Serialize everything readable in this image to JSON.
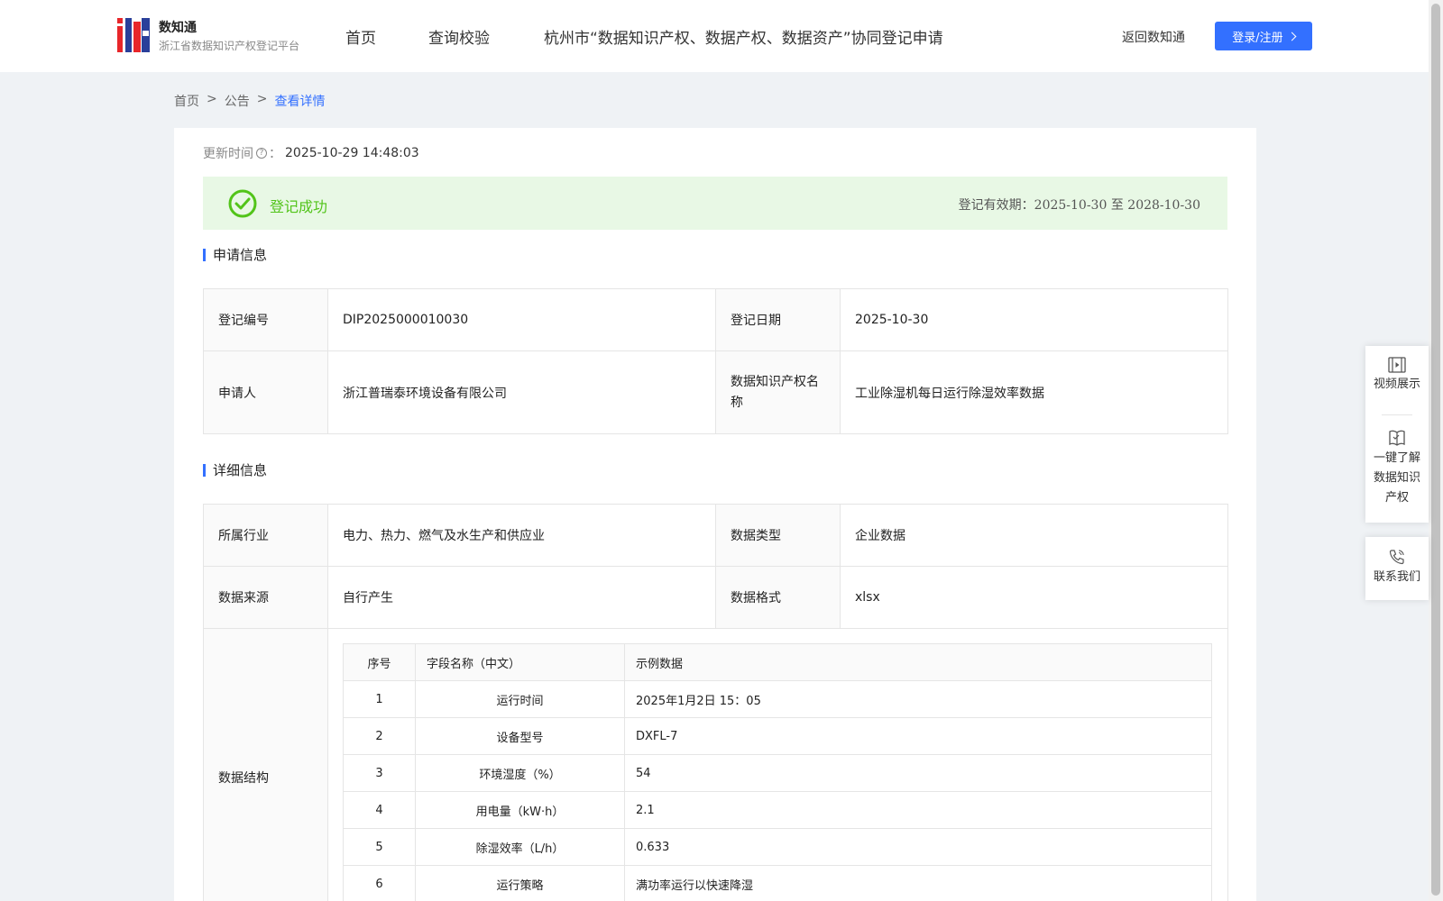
{
  "header": {
    "logo_title": "数知通",
    "logo_subtitle": "浙江省数据知识产权登记平台",
    "nav": [
      "首页",
      "查询校验",
      "杭州市“数据知识产权、数据产权、数据资产”协同登记申请"
    ],
    "back_link": "返回数知通",
    "login_label": "登录/注册"
  },
  "breadcrumb": {
    "home": "首页",
    "sep": ">",
    "notice": "公告",
    "current": "查看详情"
  },
  "update": {
    "label": "更新时间",
    "colon": "：",
    "value": "2025-10-29 14:48:03"
  },
  "status": {
    "text": "登记成功",
    "validity_label": "登记有效期：",
    "validity_start": "2025-10-30",
    "validity_to": "至",
    "validity_end": "2028-10-30"
  },
  "apply_info": {
    "title": "申请信息",
    "reg_no_label": "登记编号",
    "reg_no": "DIP2025000010030",
    "reg_date_label": "登记日期",
    "reg_date": "2025-10-30",
    "applicant_label": "申请人",
    "applicant": "浙江普瑞泰环境设备有限公司",
    "ip_name_label": "数据知识产权名称",
    "ip_name": "工业除湿机每日运行除湿效率数据"
  },
  "detail_info": {
    "title": "详细信息",
    "industry_label": "所属行业",
    "industry": "电力、热力、燃气及水生产和供应业",
    "data_type_label": "数据类型",
    "data_type": "企业数据",
    "source_label": "数据来源",
    "source": "自行产生",
    "format_label": "数据格式",
    "format": "xlsx",
    "structure_label": "数据结构",
    "structure_headers": [
      "序号",
      "字段名称（中文）",
      "示例数据"
    ],
    "structure_rows": [
      [
        "1",
        "运行时间",
        "2025年1月2日 15：05"
      ],
      [
        "2",
        "设备型号",
        "DXFL-7"
      ],
      [
        "3",
        "环境湿度（%）",
        "54"
      ],
      [
        "4",
        "用电量（kW·h）",
        "2.1"
      ],
      [
        "5",
        "除湿效率（L/h）",
        "0.633"
      ],
      [
        "6",
        "运行策略",
        "满功率运行以快速降湿"
      ]
    ]
  },
  "float_panel": {
    "video": "视频展示",
    "learn": "一键了解数据知识产权",
    "contact": "联系我们"
  },
  "colors": {
    "accent": "#3370ff",
    "success": "#52c41a",
    "success_bg": "#e8f8e5",
    "page_bg": "#eff2f5",
    "logo_red": "#e8262a",
    "logo_blue": "#2a3f9a"
  },
  "icons": [
    "logo-mark",
    "question-circle-icon",
    "check-circle-icon",
    "chevron-right-icon",
    "video-icon",
    "book-icon",
    "phone-icon"
  ]
}
